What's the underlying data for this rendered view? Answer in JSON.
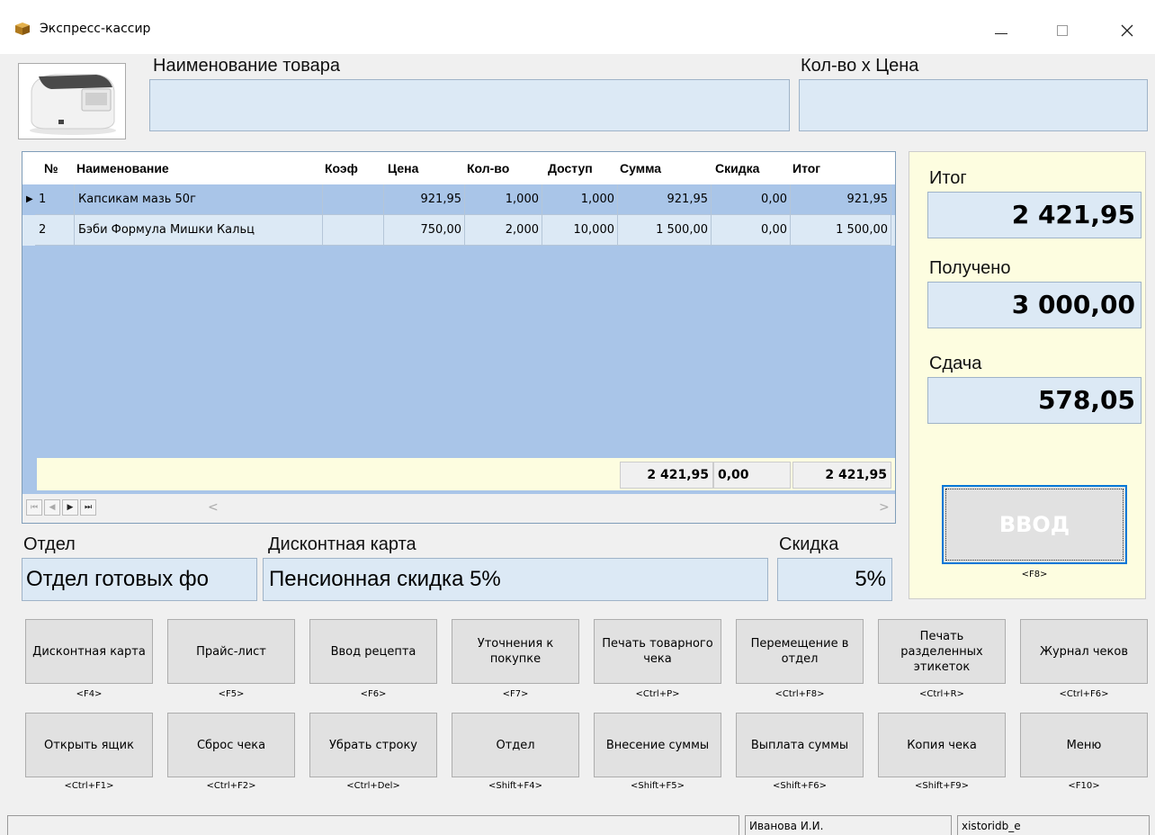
{
  "window": {
    "title": "Экспресс-кассир"
  },
  "labels": {
    "product_name": "Наименование товара",
    "qty_price": "Кол-во х Цена",
    "dept": "Отдел",
    "discount_card": "Дисконтная карта",
    "discount": "Скидка"
  },
  "inputs": {
    "product_name": "",
    "qty_price": ""
  },
  "grid": {
    "columns": [
      "№",
      "Наименование",
      "Коэф",
      "Цена",
      "Кол-во",
      "Доступ",
      "Сумма",
      "Скидка",
      "Итог"
    ],
    "rows": [
      {
        "num": "1",
        "name": "Капсикам мазь 50г",
        "coef": "",
        "price": "921,95",
        "qty": "1,000",
        "avail": "1,000",
        "sum": "921,95",
        "disc": "0,00",
        "total": "921,95"
      },
      {
        "num": "2",
        "name": "Бэби Формула Мишки Кальц",
        "coef": "",
        "price": "750,00",
        "qty": "2,000",
        "avail": "10,000",
        "sum": "1 500,00",
        "disc": "0,00",
        "total": "1 500,00"
      }
    ],
    "totals": {
      "sum": "2 421,95",
      "disc": "0,00",
      "total": "2 421,95"
    },
    "nav": {
      "first": "⏮",
      "prev": "◀",
      "next": "▶",
      "last": "⏭",
      "scroll_left": "<",
      "scroll_right": ">"
    }
  },
  "summary": {
    "total_label": "Итог",
    "total_value": "2 421,95",
    "received_label": "Получено",
    "received_value": "3 000,00",
    "change_label": "Сдача",
    "change_value": "578,05",
    "enter_label": "ВВОД",
    "enter_hint": "<F8>"
  },
  "dept_value": "Отдел готовых фо",
  "card_value": "Пенсионная скидка 5%",
  "discount_value": "5%",
  "buttons": [
    {
      "label": "Дисконтная карта",
      "hint": "<F4>"
    },
    {
      "label": "Прайс-лист",
      "hint": "<F5>"
    },
    {
      "label": "Ввод рецепта",
      "hint": "<F6>"
    },
    {
      "label": "Уточнения к покупке",
      "hint": "<F7>"
    },
    {
      "label": "Печать товарного чека",
      "hint": "<Ctrl+P>"
    },
    {
      "label": "Перемещение в отдел",
      "hint": "<Ctrl+F8>"
    },
    {
      "label": "Печать разделенных этикеток",
      "hint": "<Ctrl+R>"
    },
    {
      "label": "Журнал чеков",
      "hint": "<Ctrl+F6>"
    },
    {
      "label": "Открыть ящик",
      "hint": "<Ctrl+F1>"
    },
    {
      "label": "Сброс чека",
      "hint": "<Ctrl+F2>"
    },
    {
      "label": "Убрать строку",
      "hint": "<Ctrl+Del>"
    },
    {
      "label": "Отдел",
      "hint": "<Shift+F4>"
    },
    {
      "label": "Внесение суммы",
      "hint": "<Shift+F5>"
    },
    {
      "label": "Выплата суммы",
      "hint": "<Shift+F6>"
    },
    {
      "label": "Копия чека",
      "hint": "<Shift+F9>"
    },
    {
      "label": "Меню",
      "hint": "<F10>"
    }
  ],
  "status": {
    "pane1": "",
    "user": "Иванова И.И.",
    "db": "xistoridb_e"
  }
}
